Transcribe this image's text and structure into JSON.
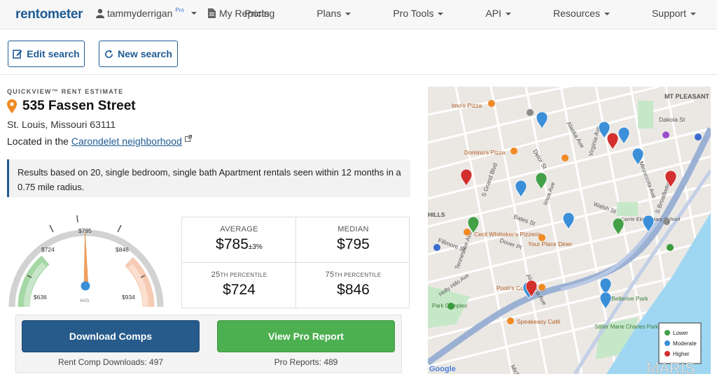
{
  "nav": {
    "logo_left": "rent",
    "logo_o": "o",
    "logo_right": "meter",
    "username": "tammyderrigan",
    "pro_badge": "Pro",
    "my_reports": "My Reports",
    "menu": [
      "Pricing",
      "Plans",
      "Pro Tools",
      "API",
      "Resources",
      "Support"
    ]
  },
  "actions": {
    "edit_search": "Edit search",
    "new_search": "New search"
  },
  "estimate": {
    "section_label": "QUICKVIEW™ RENT ESTIMATE",
    "address": "535 Fassen Street",
    "city_line": "St. Louis, Missouri 63111",
    "located_prefix": "Located in the",
    "neighborhood": "Carondelet neighborhood",
    "results_note": "Results based on 20, single bedroom, single bath Apartment rentals seen within 12 months in a 0.75 mile radius."
  },
  "gauge": {
    "labels": [
      "$636",
      "$724",
      "$795",
      "$846",
      "$934"
    ],
    "avg_label": "AVG",
    "needle_value": 785,
    "min": 636,
    "max": 934
  },
  "stats": {
    "average_label": "AVERAGE",
    "average_value": "$785",
    "average_margin": "±3%",
    "median_label": "MEDIAN",
    "median_value": "$795",
    "p25_prefix": "25",
    "p25_suffix": "TH PERCENTILE",
    "p25_value": "$724",
    "p75_prefix": "75",
    "p75_suffix": "TH PERCENTILE",
    "p75_value": "$846"
  },
  "downloads": {
    "download_comps": "Download Comps",
    "comp_count": "Rent Comp Downloads: 497",
    "view_pro": "View Pro Report",
    "pro_count": "Pro Reports: 489"
  },
  "map": {
    "places": [
      "Imo's Pizza",
      "Domino's Pizza",
      "Cecil Whittaker's Pizzeria",
      "Your Place Diner",
      "Pooh's Corner",
      "Speakeasy Café",
      "Carrie Elementary School",
      "Bellerive Park",
      "Sister Marie Charles Park",
      "MT PLEASANT",
      "HILLS",
      "Park Complex",
      "Holly Hills Ave"
    ],
    "streets": [
      "Virginia Ave",
      "Delor St",
      "Bates St",
      "Dover Pl",
      "S Grand Blvd",
      "Michigan Ave",
      "S Broadway St",
      "Minnesota Ave",
      "Iowa Ave",
      "Alaska Ave",
      "Fillmore St",
      "Walsh St",
      "Dakota St",
      "Tennessee Ave",
      "Alabama Ave"
    ],
    "legend": [
      "Lower",
      "Moderate",
      "Higher"
    ],
    "google": "Google",
    "watermark": "MARIS",
    "colors": {
      "lower": "#43a047",
      "moderate": "#3a8fd8",
      "higher": "#d32f2f"
    }
  },
  "colors": {
    "brand": "#1f5b94",
    "green": "#4caf50",
    "orange": "#f08a24"
  }
}
